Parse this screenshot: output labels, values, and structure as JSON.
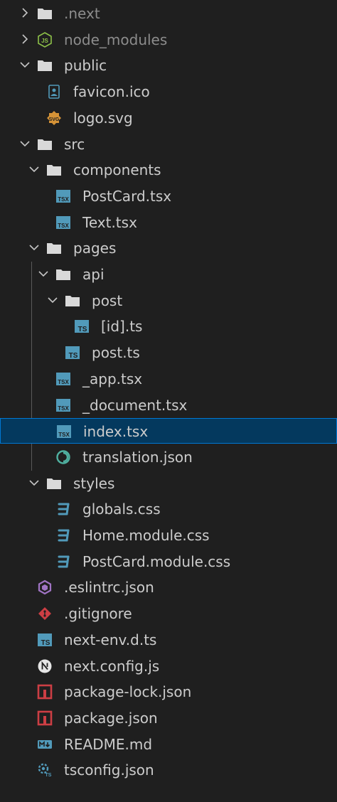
{
  "explorer": {
    "items": [
      {
        "label": ".next",
        "kind": "folder",
        "expanded": false,
        "depth": 0,
        "icon": "folder-icon",
        "dim": true
      },
      {
        "label": "node_modules",
        "kind": "folder",
        "expanded": false,
        "depth": 0,
        "icon": "nodejs-icon",
        "dim": true
      },
      {
        "label": "public",
        "kind": "folder",
        "expanded": true,
        "depth": 0,
        "icon": "folder-icon"
      },
      {
        "label": "favicon.ico",
        "kind": "file",
        "depth": 1,
        "icon": "image-file-icon"
      },
      {
        "label": "logo.svg",
        "kind": "file",
        "depth": 1,
        "icon": "svg-file-icon"
      },
      {
        "label": "src",
        "kind": "folder",
        "expanded": true,
        "depth": 0,
        "icon": "folder-icon"
      },
      {
        "label": "components",
        "kind": "folder",
        "expanded": true,
        "depth": 1,
        "icon": "folder-icon"
      },
      {
        "label": "PostCard.tsx",
        "kind": "file",
        "depth": 2,
        "icon": "tsx-file-icon"
      },
      {
        "label": "Text.tsx",
        "kind": "file",
        "depth": 2,
        "icon": "tsx-file-icon"
      },
      {
        "label": "pages",
        "kind": "folder",
        "expanded": true,
        "depth": 1,
        "icon": "folder-icon"
      },
      {
        "label": "api",
        "kind": "folder",
        "expanded": true,
        "depth": 2,
        "icon": "folder-icon"
      },
      {
        "label": "post",
        "kind": "folder",
        "expanded": true,
        "depth": 3,
        "icon": "folder-icon"
      },
      {
        "label": "[id].ts",
        "kind": "file",
        "depth": 4,
        "icon": "ts-file-icon"
      },
      {
        "label": "post.ts",
        "kind": "file",
        "depth": 3,
        "icon": "ts-file-icon"
      },
      {
        "label": "_app.tsx",
        "kind": "file",
        "depth": 2,
        "icon": "tsx-file-icon"
      },
      {
        "label": "_document.tsx",
        "kind": "file",
        "depth": 2,
        "icon": "tsx-file-icon"
      },
      {
        "label": "index.tsx",
        "kind": "file",
        "depth": 2,
        "icon": "tsx-file-icon",
        "selected": true
      },
      {
        "label": "translation.json",
        "kind": "file",
        "depth": 2,
        "icon": "i18n-json-icon"
      },
      {
        "label": "styles",
        "kind": "folder",
        "expanded": true,
        "depth": 1,
        "icon": "folder-icon"
      },
      {
        "label": "globals.css",
        "kind": "file",
        "depth": 2,
        "icon": "css-file-icon"
      },
      {
        "label": "Home.module.css",
        "kind": "file",
        "depth": 2,
        "icon": "css-file-icon"
      },
      {
        "label": "PostCard.module.css",
        "kind": "file",
        "depth": 2,
        "icon": "css-file-icon"
      },
      {
        "label": ".eslintrc.json",
        "kind": "file",
        "depth": 0,
        "icon": "eslint-icon"
      },
      {
        "label": ".gitignore",
        "kind": "file",
        "depth": 0,
        "icon": "git-icon"
      },
      {
        "label": "next-env.d.ts",
        "kind": "file",
        "depth": 0,
        "icon": "ts-file-icon"
      },
      {
        "label": "next.config.js",
        "kind": "file",
        "depth": 0,
        "icon": "nextjs-icon"
      },
      {
        "label": "package-lock.json",
        "kind": "file",
        "depth": 0,
        "icon": "npm-icon"
      },
      {
        "label": "package.json",
        "kind": "file",
        "depth": 0,
        "icon": "npm-icon"
      },
      {
        "label": "README.md",
        "kind": "file",
        "depth": 0,
        "icon": "markdown-icon"
      },
      {
        "label": "tsconfig.json",
        "kind": "file",
        "depth": 0,
        "icon": "tsconfig-icon"
      }
    ]
  },
  "colors": {
    "background": "#1f1f1f",
    "text": "#cccccc",
    "dim_text": "#8c8c8c",
    "selection_bg": "#04395e",
    "selection_border": "#0078d4",
    "ts_blue": "#519aba",
    "css_blue": "#519aba",
    "npm_red": "#cc3e44",
    "git_red": "#cc3e44",
    "svg_orange": "#d59337",
    "eslint_purple": "#a074c4",
    "i18n_teal": "#4fb0a0",
    "node_green": "#8dc149"
  }
}
